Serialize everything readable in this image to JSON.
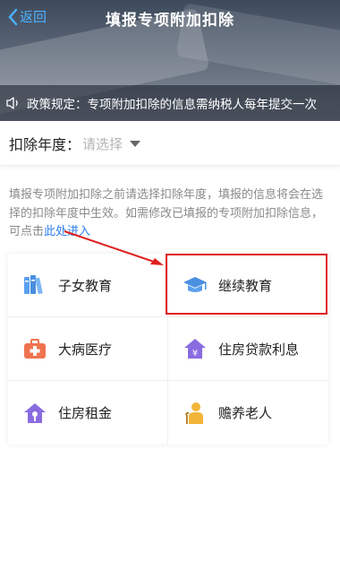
{
  "header": {
    "back_label": "返回",
    "title": "填报专项附加扣除"
  },
  "notice": {
    "text": "政策规定：专项附加扣除的信息需纳税人每年提交一次"
  },
  "year": {
    "label": "扣除年度：",
    "placeholder": "请选择"
  },
  "description": {
    "text": "填报专项附加扣除之前请选择扣除年度，填报的信息将会在选择的扣除年度中生效。如需修改已填报的专项附加扣除信息，可点击",
    "link": "此处进入"
  },
  "items": [
    {
      "label": "子女教育",
      "icon": "books-icon"
    },
    {
      "label": "继续教育",
      "icon": "graduation-cap-icon"
    },
    {
      "label": "大病医疗",
      "icon": "medical-kit-icon"
    },
    {
      "label": "住房贷款利息",
      "icon": "house-loan-icon"
    },
    {
      "label": "住房租金",
      "icon": "house-key-icon"
    },
    {
      "label": "赡养老人",
      "icon": "elderly-person-icon"
    }
  ],
  "colors": {
    "accent_blue": "#2f80ed",
    "back_blue": "#4db2ff",
    "annotation_red": "#e02020"
  }
}
